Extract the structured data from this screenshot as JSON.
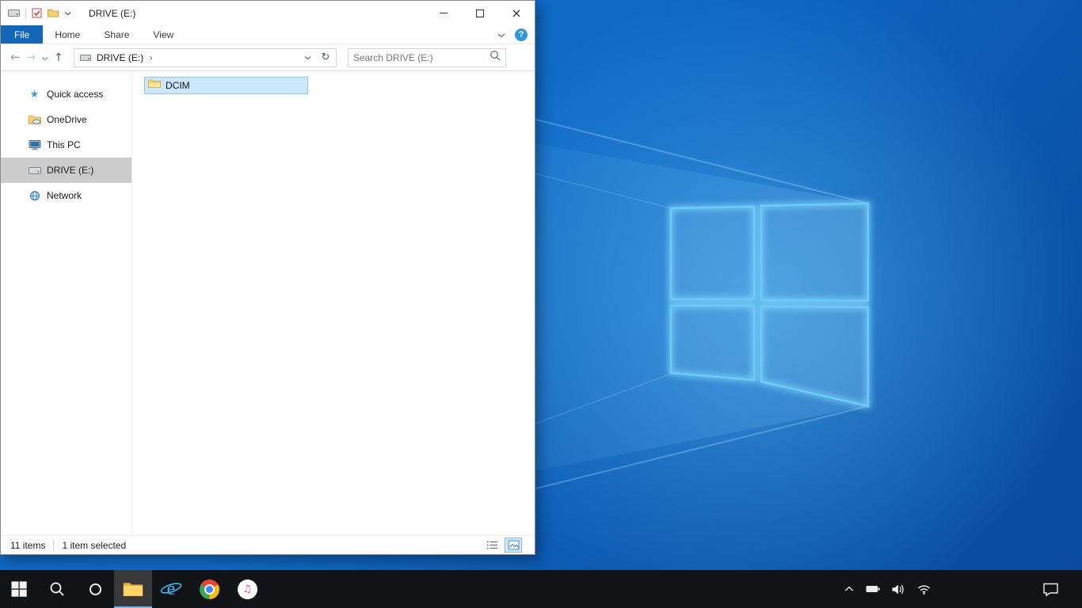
{
  "colors": {
    "accent_blue": "#1467b8",
    "file_selection_bg": "#cce8ff",
    "file_selection_border": "#8ec8f2",
    "sidebar_selected_bg": "#cccccc",
    "taskbar_bg": "#121316",
    "wallpaper_base": "#0f6ac6",
    "wallpaper_logo": "#66cef8",
    "folder_yellow": "#ffd86b"
  },
  "explorer": {
    "title": "DRIVE (E:)",
    "tabs": {
      "file": "File",
      "home": "Home",
      "share": "Share",
      "view": "View"
    },
    "toolbar": {
      "crumb": "DRIVE (E:)",
      "search_placeholder": "Search DRIVE (E:)"
    },
    "sidebar": {
      "items": [
        {
          "label": "Quick access",
          "icon": "star-icon",
          "selected": false
        },
        {
          "label": "OneDrive",
          "icon": "onedrive-icon",
          "selected": false
        },
        {
          "label": "This PC",
          "icon": "this-pc-icon",
          "selected": false
        },
        {
          "label": "DRIVE (E:)",
          "icon": "drive-icon",
          "selected": true
        },
        {
          "label": "Network",
          "icon": "network-icon",
          "selected": false
        }
      ]
    },
    "files": [
      {
        "name": "DCIM",
        "type": "folder",
        "selected": true
      }
    ],
    "status": {
      "items_count": "11 items",
      "selection": "1 item selected"
    }
  },
  "glyphs": {
    "back": "←",
    "forward": "→",
    "up": "↑",
    "refresh": "↻",
    "crumb_sep": "›",
    "help": "?",
    "close": "×",
    "star": "★",
    "itunes_note": "♫"
  },
  "taskbar": {
    "buttons": [
      "start",
      "search",
      "cortana",
      "file-explorer",
      "internet-explorer",
      "chrome",
      "itunes"
    ],
    "active_button": "file-explorer",
    "tray_icons": [
      "hidden-icons-chevron",
      "battery",
      "volume",
      "network-wifi",
      "action-center"
    ]
  }
}
